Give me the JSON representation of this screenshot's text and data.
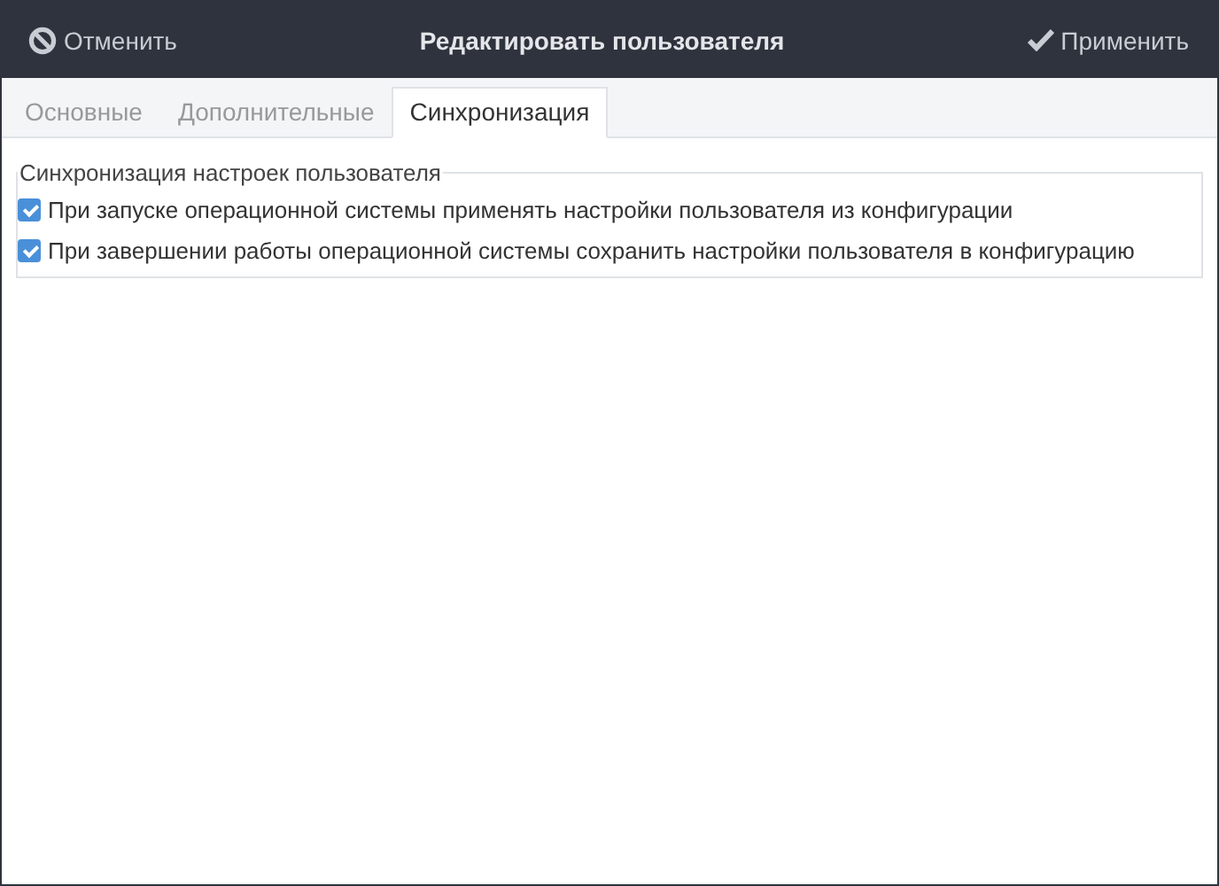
{
  "header": {
    "cancel": "Отменить",
    "title": "Редактировать пользователя",
    "apply": "Применить"
  },
  "tabs": [
    {
      "label": "Основные",
      "selected": false
    },
    {
      "label": "Дополнительные",
      "selected": false
    },
    {
      "label": "Синхронизация",
      "selected": true
    }
  ],
  "group": {
    "title": "Синхронизация настроек пользователя",
    "options": [
      {
        "label": "При запуске операционной системы применять настройки пользователя из конфигурации",
        "checked": true
      },
      {
        "label": "При завершении работы операционной системы сохранить настройки пользователя в конфигурацию",
        "checked": true
      }
    ]
  }
}
